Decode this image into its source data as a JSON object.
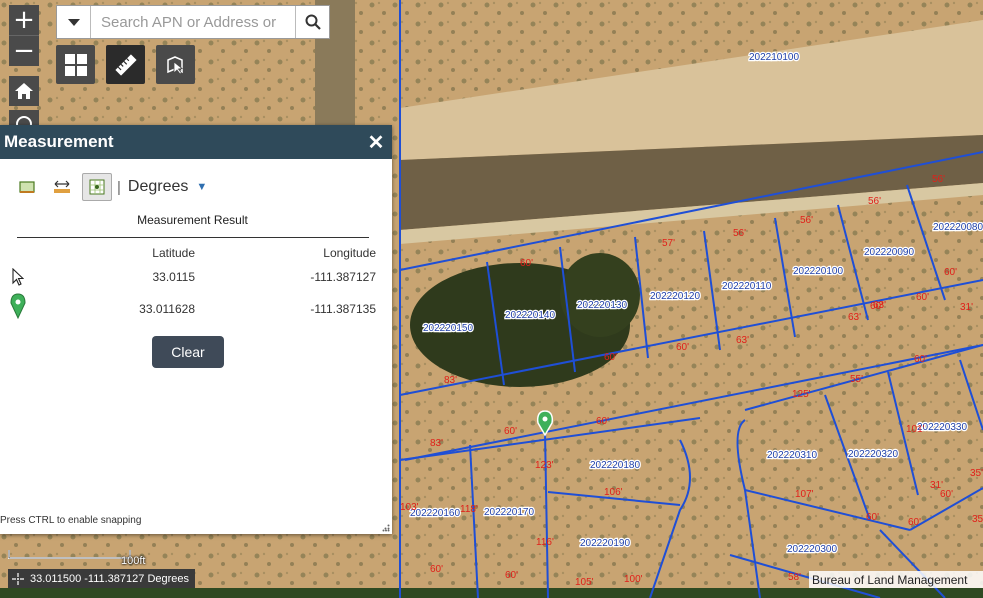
{
  "search": {
    "placeholder": "Search APN or Address or"
  },
  "panel": {
    "title": "Measurement",
    "unit": "Degrees",
    "result_title": "Measurement Result",
    "col_lat": "Latitude",
    "col_lon": "Longitude",
    "rows": [
      {
        "lat": "33.0115",
        "lon": "-111.387127"
      },
      {
        "lat": "33.011628",
        "lon": "-111.387135"
      }
    ],
    "clear_label": "Clear",
    "snap_hint": "Press CTRL to enable snapping"
  },
  "status": {
    "coordinates": "33.011500 -111.387127 Degrees",
    "scale_label": "100ft"
  },
  "attribution": "Bureau of Land Management",
  "parcels": [
    "202210100",
    "202220080",
    "202220090",
    "202220100",
    "202220110",
    "202220120",
    "202220130",
    "202220140",
    "202220150",
    "202220330",
    "202220320",
    "202220310",
    "202220180",
    "202220170",
    "202220160",
    "202220190",
    "202220300"
  ],
  "dimensions": [
    "56'",
    "56'",
    "56'",
    "56'",
    "57'",
    "60'",
    "60'",
    "60'",
    "63'",
    "63'",
    "63'",
    "60'",
    "60'",
    "55'",
    "60'",
    "83'",
    "83'",
    "60'",
    "60'",
    "60'",
    "60'",
    "125'",
    "107'",
    "101'",
    "31'",
    "35'",
    "35'",
    "60'",
    "60'",
    "106'",
    "118'",
    "116'",
    "103'",
    "100'",
    "105'",
    "60'",
    "58'",
    "60'",
    "123'",
    "31'"
  ],
  "colors": {
    "parcel_line": "#1f4fd6",
    "dim_label": "#e0201a",
    "panel_header": "#2f4a5a",
    "clear_button": "#3f4a58",
    "toolbar": "#4a4a4a"
  }
}
